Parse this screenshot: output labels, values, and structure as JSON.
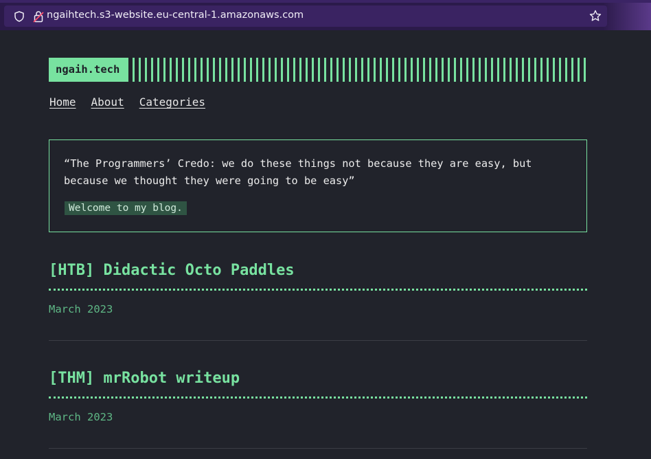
{
  "browser": {
    "url": "ngaihtech.s3-website.eu-central-1.amazonaws.com"
  },
  "site": {
    "logo": "ngaih.tech",
    "accent_color": "#78e2a0",
    "background_color": "#21232b"
  },
  "nav": {
    "items": [
      {
        "label": "Home"
      },
      {
        "label": "About"
      },
      {
        "label": "Categories"
      }
    ]
  },
  "intro": {
    "quote": "“The Programmers’ Credo: we do these things not because they are easy, but because we thought they were going to be easy”",
    "welcome": "Welcome to my blog."
  },
  "posts": [
    {
      "title": "[HTB] Didactic Octo Paddles",
      "date": "March 2023"
    },
    {
      "title": "[THM] mrRobot writeup",
      "date": "March 2023"
    }
  ]
}
